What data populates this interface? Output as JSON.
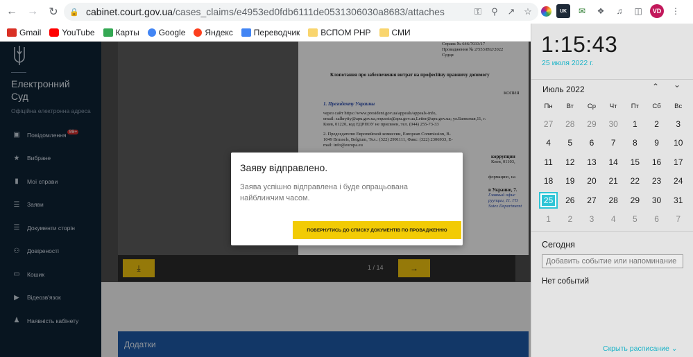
{
  "browser": {
    "url_host": "cabinet.court.gov.ua",
    "url_path": "/cases_claims/e4953ed0fdb6111de0531306030a8683/attaches",
    "profile_initials": "VD",
    "ext_badge": "UK"
  },
  "bookmarks": [
    {
      "label": "Gmail",
      "color": "#d93025"
    },
    {
      "label": "YouTube",
      "color": "#ff0000"
    },
    {
      "label": "Карты",
      "color": "#34a853"
    },
    {
      "label": "Google",
      "color": "#4285f4"
    },
    {
      "label": "Яндекс",
      "color": "#fc3f1d"
    },
    {
      "label": "Переводчик",
      "color": "#4285f4"
    },
    {
      "label": "ВСПОМ РНР",
      "color": "#f9d56e"
    },
    {
      "label": "СМИ",
      "color": "#f9d56e"
    }
  ],
  "sidebar": {
    "brand_line1": "Електронний",
    "brand_line2": "Суд",
    "brand_sub": "Офіційна електронна адреса",
    "items": [
      {
        "label": "Повідомлення",
        "icon": "message-icon",
        "badge": "99+"
      },
      {
        "label": "Вибране",
        "icon": "star-icon"
      },
      {
        "label": "Мої справи",
        "icon": "folder-icon"
      },
      {
        "label": "Заяви",
        "icon": "list-icon"
      },
      {
        "label": "Документи сторін",
        "icon": "documents-icon"
      },
      {
        "label": "Довіреності",
        "icon": "people-icon"
      },
      {
        "label": "Кошик",
        "icon": "trash-icon"
      },
      {
        "label": "Відеозв'язок",
        "icon": "video-icon"
      },
      {
        "label": "Наявність кабінету",
        "icon": "person-icon"
      }
    ]
  },
  "document": {
    "ref1": "Справа № 646/7033/17",
    "ref2": "Провадження № 2/553/892/2022",
    "ref3": "Судця",
    "title": "Клопотання про забезпечення витрат на професійну правничу допомогу",
    "copy": "КОПИЯ",
    "addr1": "1. Президенту Украины",
    "addr2": "через сайт https://www.president.gov.ua/appeals/appeals-info,",
    "addr3": "email: zalkrytiy@apu.gov.ua,requests@apu.gov.ua,Letter@apu.gov.ua; ул.Банковая,11, г.",
    "addr4": "Киев, 01220, код ЕДРПОУ не присвоен, тел. (044) 255-73-33",
    "addr5": "2. Председателю Европейской комиссии, European Commission, B-",
    "addr6": "1049 Brussels, Belgium, Тел.: (322) 2991111, Факс: (322) 2306933, E-",
    "addr7": "mail: info@europa.eu",
    "frag1": "коррупции",
    "frag2": "Киев, 01103,",
    "frag3": "формацию, на",
    "frag4": "в Украине, 7.",
    "frag5": "Главный офис",
    "frag6": "руупции, 11. ГО",
    "frag7": "Sutex Departmemt"
  },
  "viewer": {
    "page_indicator": "1 / 14",
    "download_icon": "download-icon",
    "next_icon": "arrow-right-icon"
  },
  "attachments_label": "Додатки",
  "modal": {
    "title": "Заяву відправлено.",
    "body": "Заява успішно відправлена і буде опрацьована найближчим часом.",
    "button": "ПОВЕРНУТИСЬ ДО СПИСКУ ДОКУМЕНТІВ ПО ПРОВАДЖЕННЮ"
  },
  "calendar": {
    "time": "1:15:43",
    "date": "25 июля 2022 г.",
    "month": "Июль 2022",
    "weekdays": [
      "Пн",
      "Вт",
      "Ср",
      "Чт",
      "Пт",
      "Сб",
      "Вс"
    ],
    "days": [
      [
        "27",
        "28",
        "29",
        "30",
        "1",
        "2",
        "3"
      ],
      [
        "4",
        "5",
        "6",
        "7",
        "8",
        "9",
        "10"
      ],
      [
        "11",
        "12",
        "13",
        "14",
        "15",
        "16",
        "17"
      ],
      [
        "18",
        "19",
        "20",
        "21",
        "22",
        "23",
        "24"
      ],
      [
        "25",
        "26",
        "27",
        "28",
        "29",
        "30",
        "31"
      ],
      [
        "1",
        "2",
        "3",
        "4",
        "5",
        "6",
        "7"
      ]
    ],
    "today_label": "Сегодня",
    "event_placeholder": "Добавить событие или напоминание",
    "no_events": "Нет событий",
    "hide_schedule": "Скрыть расписание"
  },
  "colors": {
    "sidebar_bg": "#0d2235",
    "accent_yellow": "#f2cb05",
    "calendar_accent": "#2ec4d6",
    "attach_blue": "#1d5aa6"
  }
}
